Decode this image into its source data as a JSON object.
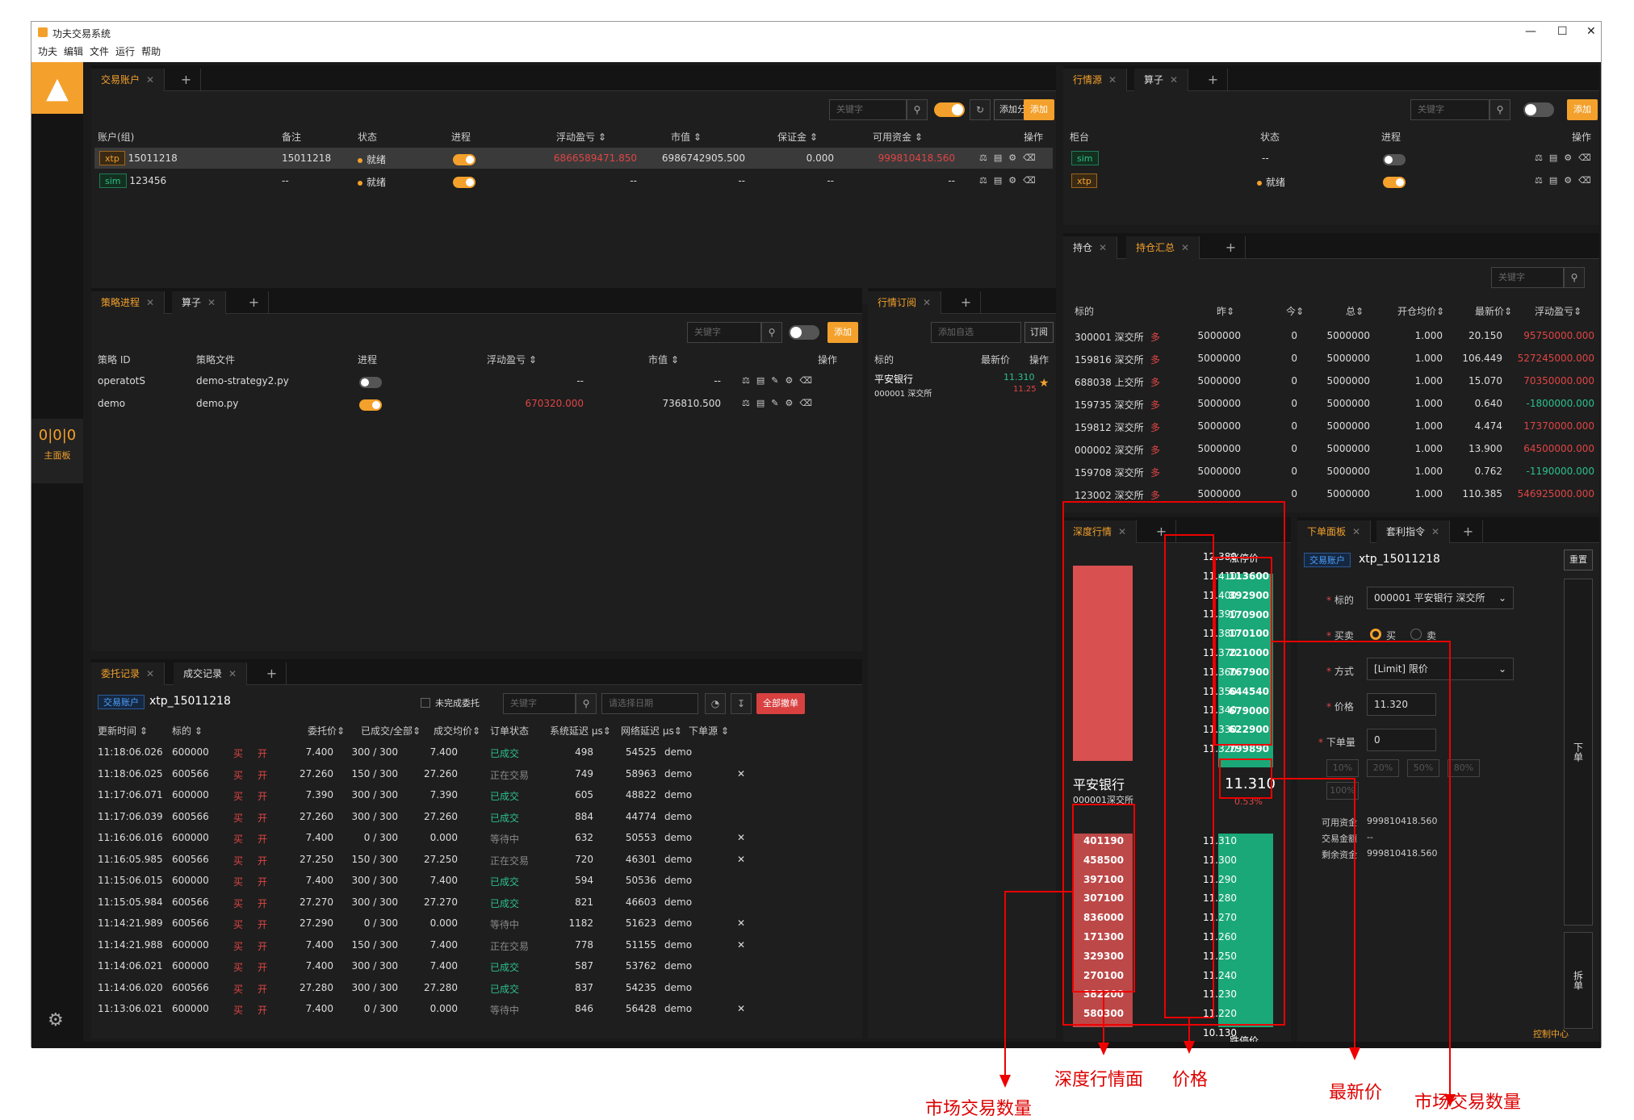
{
  "window": {
    "title": "功夫交易系统",
    "controls": [
      "—",
      "☐",
      "✕"
    ]
  },
  "menu": [
    "功夫",
    "编辑",
    "文件",
    "运行",
    "帮助"
  ],
  "side": {
    "dashboard_label": "主面板",
    "dashboard_icon": "0|0|0"
  },
  "account_panel": {
    "tabs": [
      "交易账户"
    ],
    "search_placeholder": "关键字",
    "add_group": "添加分组",
    "add": "添加",
    "headers": [
      "账户(组)",
      "备注",
      "状态",
      "进程",
      "浮动盈亏 ⇕",
      "市值 ⇕",
      "保证金 ⇕",
      "可用资金 ⇕",
      "操作"
    ],
    "rows": [
      {
        "tag": "xtp",
        "id": "15011218",
        "note": "15011218",
        "status": "就绪",
        "pnl": "6866589471.850",
        "mv": "6986742905.500",
        "margin": "0.000",
        "avail": "999810418.560",
        "on": true
      },
      {
        "tag": "sim",
        "id": "123456",
        "note": "--",
        "status": "就绪",
        "pnl": "--",
        "mv": "--",
        "margin": "--",
        "avail": "--",
        "on": true
      }
    ]
  },
  "md_source_panel": {
    "tabs": [
      "行情源",
      "算子"
    ],
    "search_placeholder": "关键字",
    "add": "添加",
    "headers": [
      "柜台",
      "状态",
      "进程",
      "操作"
    ],
    "rows": [
      {
        "tag": "sim",
        "status": "--",
        "on": false
      },
      {
        "tag": "xtp",
        "status": "就绪",
        "on": true
      }
    ]
  },
  "position_panel": {
    "tabs": [
      "持仓",
      "持仓汇总"
    ],
    "search_placeholder": "关键字",
    "headers": [
      "标的",
      "昨⇕",
      "今⇕",
      "总⇕",
      "开仓均价⇕",
      "最新价⇕",
      "浮动盈亏⇕"
    ],
    "rows": [
      {
        "code": "300001 深交所",
        "dir": "多",
        "yd": "5000000",
        "td": "0",
        "total": "5000000",
        "avg": "1.000",
        "last": "20.150",
        "pnl": "95750000.000"
      },
      {
        "code": "159816 深交所",
        "dir": "多",
        "yd": "5000000",
        "td": "0",
        "total": "5000000",
        "avg": "1.000",
        "last": "106.449",
        "pnl": "527245000.000"
      },
      {
        "code": "688038 上交所",
        "dir": "多",
        "yd": "5000000",
        "td": "0",
        "total": "5000000",
        "avg": "1.000",
        "last": "15.070",
        "pnl": "70350000.000"
      },
      {
        "code": "159735 深交所",
        "dir": "多",
        "yd": "5000000",
        "td": "0",
        "total": "5000000",
        "avg": "1.000",
        "last": "0.640",
        "pnl": "-1800000.000"
      },
      {
        "code": "159812 深交所",
        "dir": "多",
        "yd": "5000000",
        "td": "0",
        "total": "5000000",
        "avg": "1.000",
        "last": "4.474",
        "pnl": "17370000.000"
      },
      {
        "code": "000002 深交所",
        "dir": "多",
        "yd": "5000000",
        "td": "0",
        "total": "5000000",
        "avg": "1.000",
        "last": "13.900",
        "pnl": "64500000.000"
      },
      {
        "code": "159708 深交所",
        "dir": "多",
        "yd": "5000000",
        "td": "0",
        "total": "5000000",
        "avg": "1.000",
        "last": "0.762",
        "pnl": "-1190000.000"
      },
      {
        "code": "123002 深交所",
        "dir": "多",
        "yd": "5000000",
        "td": "0",
        "total": "5000000",
        "avg": "1.000",
        "last": "110.385",
        "pnl": "546925000.000"
      }
    ]
  },
  "strategy_panel": {
    "tabs": [
      "策略进程",
      "算子"
    ],
    "search_placeholder": "关键字",
    "add": "添加",
    "headers": [
      "策略 ID",
      "策略文件",
      "进程",
      "浮动盈亏 ⇕",
      "市值 ⇕",
      "操作"
    ],
    "rows": [
      {
        "id": "operatotS",
        "file": "demo-strategy2.py",
        "pnl": "--",
        "mv": "--",
        "on": false
      },
      {
        "id": "demo",
        "file": "demo.py",
        "pnl": "670320.000",
        "mv": "736810.500",
        "on": true
      }
    ]
  },
  "sub_panel": {
    "tabs": [
      "行情订阅"
    ],
    "add_placeholder": "添加自选",
    "subscribe": "订阅",
    "headers": [
      "标的",
      "最新价",
      "操作"
    ],
    "row": {
      "name": "平安银行",
      "code": "000001 深交所",
      "last": "11.310",
      "chg": "11.25"
    }
  },
  "orders_panel": {
    "tabs": [
      "委托记录",
      "成交记录"
    ],
    "account_tag": "交易账户",
    "account": "xtp_15011218",
    "unfinished": "未完成委托",
    "search_placeholder": "关键字",
    "date_placeholder": "请选择日期",
    "cancel_all": "全部撤单",
    "headers": [
      "更新时间 ⇕",
      "标的 ⇕",
      "",
      "",
      "委托价⇕",
      "已成交/全部⇕",
      "成交均价⇕",
      "订单状态",
      "系统延迟 μs⇕",
      "网络延迟 μs⇕",
      "下单源 ⇕"
    ],
    "rows": [
      [
        "11:18:06.026",
        "600000",
        "买",
        "开",
        "7.400",
        "300 / 300",
        "7.400",
        "已成交",
        "498",
        "54525",
        "demo",
        ""
      ],
      [
        "11:18:06.025",
        "600566",
        "买",
        "开",
        "27.260",
        "150 / 300",
        "27.260",
        "正在交易",
        "749",
        "58963",
        "demo",
        "✕"
      ],
      [
        "11:17:06.071",
        "600000",
        "买",
        "开",
        "7.390",
        "300 / 300",
        "7.390",
        "已成交",
        "605",
        "48822",
        "demo",
        ""
      ],
      [
        "11:17:06.039",
        "600566",
        "买",
        "开",
        "27.260",
        "300 / 300",
        "27.260",
        "已成交",
        "884",
        "44774",
        "demo",
        ""
      ],
      [
        "11:16:06.016",
        "600000",
        "买",
        "开",
        "7.400",
        "0 / 300",
        "0.000",
        "等待中",
        "632",
        "50553",
        "demo",
        "✕"
      ],
      [
        "11:16:05.985",
        "600566",
        "买",
        "开",
        "27.250",
        "150 / 300",
        "27.250",
        "正在交易",
        "720",
        "46301",
        "demo",
        "✕"
      ],
      [
        "11:15:06.015",
        "600000",
        "买",
        "开",
        "7.400",
        "300 / 300",
        "7.400",
        "已成交",
        "594",
        "50536",
        "demo",
        ""
      ],
      [
        "11:15:05.984",
        "600566",
        "买",
        "开",
        "27.270",
        "300 / 300",
        "27.270",
        "已成交",
        "821",
        "46603",
        "demo",
        ""
      ],
      [
        "11:14:21.989",
        "600566",
        "买",
        "开",
        "27.290",
        "0 / 300",
        "0.000",
        "等待中",
        "1182",
        "51623",
        "demo",
        "✕"
      ],
      [
        "11:14:21.988",
        "600000",
        "买",
        "开",
        "7.400",
        "150 / 300",
        "7.400",
        "正在交易",
        "778",
        "51155",
        "demo",
        "✕"
      ],
      [
        "11:14:06.021",
        "600000",
        "买",
        "开",
        "7.400",
        "300 / 300",
        "7.400",
        "已成交",
        "587",
        "53762",
        "demo",
        ""
      ],
      [
        "11:14:06.020",
        "600566",
        "买",
        "开",
        "27.280",
        "300 / 300",
        "27.280",
        "已成交",
        "837",
        "54235",
        "demo",
        ""
      ],
      [
        "11:13:06.021",
        "600000",
        "买",
        "开",
        "7.400",
        "0 / 300",
        "0.000",
        "等待中",
        "846",
        "56428",
        "demo",
        "✕"
      ]
    ]
  },
  "depth_panel": {
    "tabs": [
      "深度行情"
    ],
    "name": "平安银行",
    "code": "000001深交所",
    "limit_up_label": "涨停价",
    "limit_down_label": "跌停价",
    "upper_prices": [
      "12.380",
      "11.410",
      "11.400",
      "11.390",
      "11.380",
      "11.370",
      "11.360",
      "11.350",
      "11.340",
      "11.330",
      "11.320"
    ],
    "ask_vols": [
      "113600",
      "392900",
      "170900",
      "170100",
      "221000",
      "767900",
      "644540",
      "679000",
      "622900",
      "799890"
    ],
    "last": "11.310",
    "last_pct": "0.53%",
    "lower_prices": [
      "11.310",
      "11.300",
      "11.290",
      "11.280",
      "11.270",
      "11.260",
      "11.250",
      "11.240",
      "11.230",
      "11.220",
      "10.130"
    ],
    "bid_vols": [
      "401190",
      "458500",
      "397100",
      "307100",
      "836000",
      "171300",
      "329300",
      "270100",
      "382200",
      "580300"
    ]
  },
  "order_panel": {
    "tabs": [
      "下单面板",
      "套利指令"
    ],
    "account_tag": "交易账户",
    "account": "xtp_15011218",
    "reset": "重置",
    "instrument_label": "标的",
    "instrument": "000001 平安银行 深交所",
    "side_label": "买卖",
    "buy": "买",
    "sell": "卖",
    "method_label": "方式",
    "method": "[Limit] 限价",
    "price_label": "价格",
    "price": "11.320",
    "qty_label": "下单量",
    "qty": "0",
    "pcts": [
      "10%",
      "20%",
      "50%",
      "80%",
      "100%"
    ],
    "avail_label": "可用资金",
    "avail": "999810418.560",
    "amount_label": "交易金额",
    "amount": "--",
    "remain_label": "剩余资金",
    "remain": "999810418.560",
    "place": "下单",
    "split": "拆单"
  },
  "status": {
    "control_center": "控制中心"
  },
  "annotations": {
    "mkt_left": "市场交易数量",
    "depth": "深度行情面",
    "price": "价格",
    "last": "最新价",
    "mkt_right": "市场交易数量"
  },
  "colors": {
    "accent": "#f3a12c",
    "up": "#e04545",
    "down": "#2dc08d",
    "annotation": "#dd0000"
  }
}
